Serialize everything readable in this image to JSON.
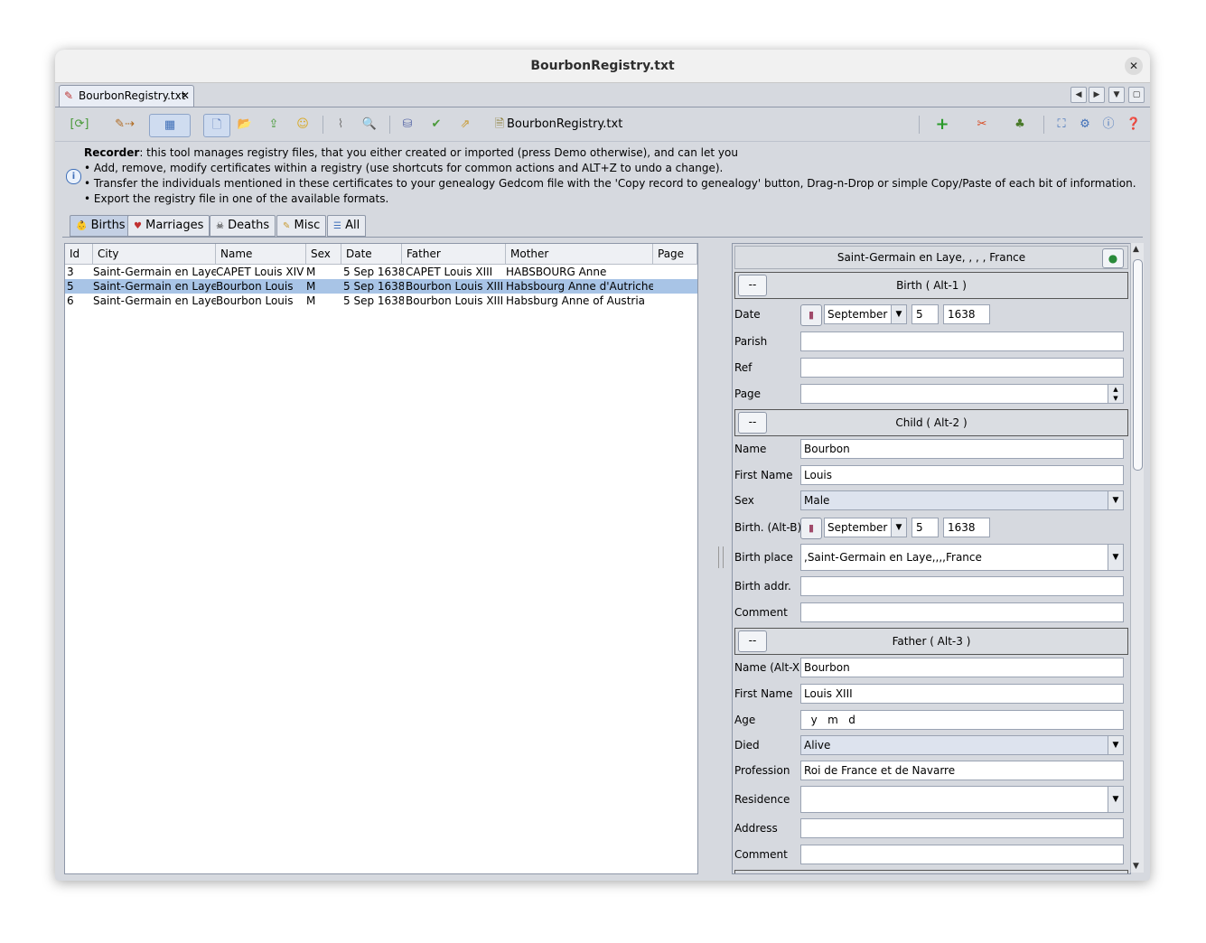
{
  "window": {
    "title": "BourbonRegistry.txt"
  },
  "doctab": {
    "label": "BourbonRegistry.txt"
  },
  "toolbar": {
    "file_label": "BourbonRegistry.txt"
  },
  "info": {
    "line1_bold": "Recorder",
    "line1_rest": ": this tool manages registry files, that you either created or imported (press Demo otherwise), and can let you",
    "line2": "• Add, remove, modify certificates within a registry (use shortcuts for common actions and ALT+Z to undo a change).",
    "line3": "• Transfer the individuals mentioned in these certificates to your genealogy Gedcom file with the 'Copy record to genealogy' button, Drag-n-Drop or simple Copy/Paste of each bit of information.",
    "line4": "• Export the registry file in one of the available formats."
  },
  "tabs": [
    "Births",
    "Marriages",
    "Deaths",
    "Misc",
    "All"
  ],
  "table": {
    "columns": [
      "Id",
      "City",
      "Name",
      "Sex",
      "Date",
      "Father",
      "Mother",
      "Page"
    ],
    "rows": [
      [
        "3",
        "Saint-Germain en Laye",
        "CAPET Louis XIV",
        "M",
        "5 Sep 1638",
        "CAPET Louis XIII",
        "HABSBOURG Anne",
        ""
      ],
      [
        "5",
        "Saint-Germain en Laye",
        "Bourbon Louis",
        "M",
        "5 Sep 1638",
        "Bourbon Louis XIII",
        "Habsbourg Anne d'Autriche",
        ""
      ],
      [
        "6",
        "Saint-Germain en Laye",
        "Bourbon Louis",
        "M",
        "5 Sep 1638",
        "Bourbon Louis XIII",
        "Habsburg Anne of Austria",
        ""
      ]
    ]
  },
  "detail": {
    "place": "Saint-Germain en Laye, , , , France",
    "mini_btn": "--",
    "birth": {
      "header": "Birth   ( Alt-1 )",
      "date_label": "Date",
      "date_month": "September",
      "date_day": "5",
      "date_year": "1638",
      "parish_label": "Parish",
      "parish": "",
      "ref_label": "Ref",
      "ref": "",
      "page_label": "Page",
      "page": ""
    },
    "child": {
      "header": "Child   ( Alt-2 )",
      "name_label": "Name",
      "name": "Bourbon",
      "firstname_label": "First Name",
      "firstname": "Louis",
      "sex_label": "Sex",
      "sex": "Male",
      "birth_label": "Birth. (Alt-B)",
      "birth_month": "September",
      "birth_day": "5",
      "birth_year": "1638",
      "birthplace_label": "Birth place",
      "birthplace": ",Saint-Germain en Laye,,,,France",
      "birthaddr_label": "Birth addr.",
      "birthaddr": "",
      "comment_label": "Comment",
      "comment": ""
    },
    "father": {
      "header": "Father   ( Alt-3 )",
      "name_label": "Name (Alt-X)",
      "name": "Bourbon",
      "firstname_label": "First Name",
      "firstname": "Louis XIII",
      "age_label": "Age",
      "age": "  y   m   d",
      "died_label": "Died",
      "died": "Alive",
      "profession_label": "Profession",
      "profession": "Roi de France et de Navarre",
      "residence_label": "Residence",
      "residence": "",
      "address_label": "Address",
      "address": "",
      "comment_label": "Comment",
      "comment": ""
    }
  }
}
